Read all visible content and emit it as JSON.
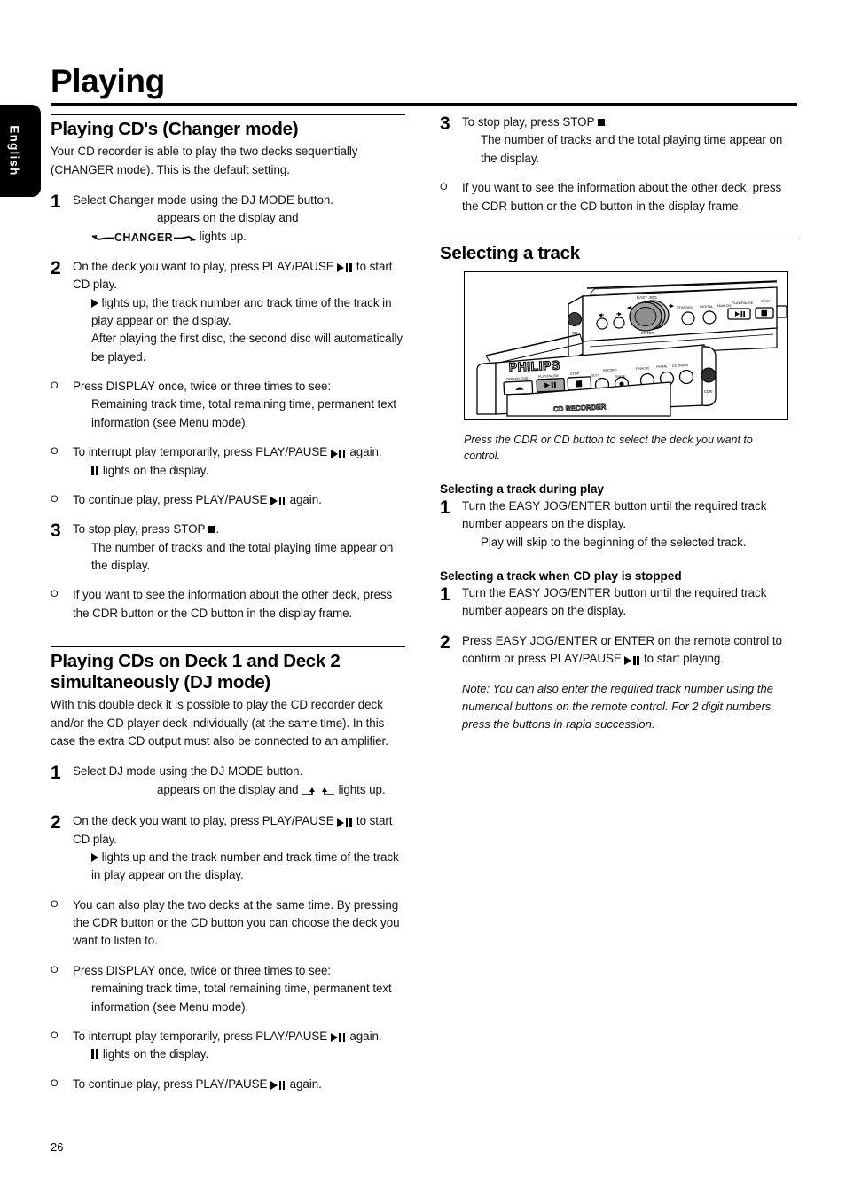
{
  "page": {
    "title": "Playing",
    "number": "26",
    "language_tab": "English"
  },
  "left_column": {
    "section1": {
      "heading": "Playing CD's (Changer mode)",
      "intro": "Your CD recorder is able to play the two decks sequentially (CHANGER mode). This is the default setting.",
      "step1": {
        "num": "1",
        "line1": "Select Changer mode using the DJ MODE button.",
        "line2": "appears on the display and",
        "indicator_label": "CHANGER",
        "line3": "lights up."
      },
      "step2": {
        "num": "2",
        "line1_a": "On the deck you want to play, press PLAY/PAUSE",
        "line1_b": "to start CD play.",
        "sub1_a": "lights up, the track number and track time of the track in play appear on the display.",
        "sub2": "After playing the first disc, the second disc will automatically be played."
      },
      "bullet1": {
        "mark": "O",
        "line1": "Press DISPLAY once, twice or three times to see:",
        "sub": "Remaining track time, total remaining time, permanent text information (see Menu mode)."
      },
      "bullet2": {
        "mark": "O",
        "line1_a": "To interrupt play temporarily, press PLAY/PAUSE",
        "line1_b": "again.",
        "sub_b": "lights on the display."
      },
      "bullet3": {
        "mark": "O",
        "line1_a": "To continue play, press PLAY/PAUSE",
        "line1_b": "again."
      },
      "step3": {
        "num": "3",
        "line1_a": "To stop play, press STOP",
        "line1_b": ".",
        "sub": "The number of tracks and the total playing time appear on the display."
      },
      "bullet4": {
        "mark": "O",
        "text": "If you want to see the information about the other deck, press the CDR button or the CD button in the display frame."
      }
    },
    "section2": {
      "heading": "Playing CDs on Deck 1 and Deck 2 simultaneously (DJ mode)",
      "intro": "With this double deck it is possible to play the CD recorder deck and/or the CD player deck individually (at the same time). In this case the extra CD output must also be connected to an amplifier.",
      "step1": {
        "num": "1",
        "line1": "Select DJ mode using the DJ MODE button.",
        "line2_a": "appears on the display and",
        "line2_b": "lights up."
      },
      "step2": {
        "num": "2",
        "line1_a": "On the deck you want to play, press PLAY/PAUSE",
        "line1_b": "to start CD play.",
        "sub_a": "lights up and the track number and track time of the track in play appear on the display."
      },
      "bullet1": {
        "mark": "O",
        "text": "You can also play the two decks at the same time. By pressing the CDR button or the CD button you can choose the deck you want to listen to."
      },
      "bullet2": {
        "mark": "O",
        "line1": "Press DISPLAY once, twice or three times to see:",
        "sub": "remaining track time, total remaining time, permanent text information (see Menu mode)."
      },
      "bullet3": {
        "mark": "O",
        "line1_a": "To interrupt play temporarily, press PLAY/PAUSE",
        "line1_b": "again.",
        "sub_b": "lights on the display."
      },
      "bullet4": {
        "mark": "O",
        "line1_a": "To continue play, press PLAY/PAUSE",
        "line1_b": "again."
      }
    }
  },
  "right_column": {
    "step3": {
      "num": "3",
      "line1_a": "To stop play, press STOP",
      "line1_b": ".",
      "sub": "The number of tracks and the total playing time appear on the display."
    },
    "bullet1": {
      "mark": "O",
      "text": "If you want to see the information about the other deck, press the CDR button or the CD button in the display frame."
    },
    "section": {
      "heading": "Selecting a track",
      "caption": "Press the CDR or CD button to select the deck you want to control.",
      "sub1": {
        "heading": "Selecting a track during play",
        "num": "1",
        "line1": "Turn the EASY JOG/ENTER button until the required track number appears on the display.",
        "sub": "Play will skip to the beginning of the selected track."
      },
      "sub2": {
        "heading": "Selecting a track when CD play is stopped",
        "step1": {
          "num": "1",
          "text": "Turn the EASY JOG/ENTER button until the required track number appears on  the display."
        },
        "step2": {
          "num": "2",
          "line_a": "Press EASY JOG/ENTER or ENTER on the remote control to confirm or press PLAY/PAUSE",
          "line_b": "to start playing."
        },
        "note": "Note: You can also enter the required track number using the numerical buttons on the remote control. For 2 digit numbers, press the buttons in rapid succession."
      }
    },
    "figure": {
      "brand": "PHILIPS",
      "labels": {
        "easy_jog": "EASY JOG",
        "enter": "ENTER",
        "cd": "CD",
        "cdr": "CDR",
        "play_pause": "PLAY/PAUSE",
        "stop": "STOP",
        "open_close": "OPEN/CLOSE",
        "record": "RECORD",
        "finalize": "FINALIZE",
        "erase": "ERASE",
        "text": "TEXT",
        "standby": "STANDBY",
        "digital": "DIGITAL",
        "analog": "ANALOG",
        "disc_display": "CD RECORDER"
      }
    }
  },
  "colors": {
    "ink": "#000000",
    "paper": "#ffffff",
    "tab_bg": "#000000",
    "tab_text": "#ffffff",
    "knob_grey": "#a6a6a6"
  }
}
